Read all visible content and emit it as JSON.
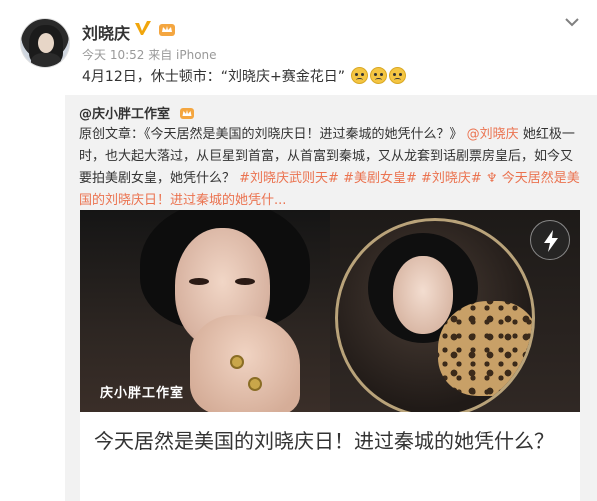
{
  "post": {
    "author_name": "刘晓庆",
    "meta": "今天 10:52 来自 iPhone",
    "text": "4月12日，休士顿市：“刘晓庆+赛金花日”"
  },
  "repost": {
    "author": "@庆小胖工作室",
    "body_prefix": "原创文章：《今天居然是美国的刘晓庆日！进过秦城的她凭什么？》",
    "mention": "@刘晓庆",
    "body_main": " 她红极一时，也大起大落过，从巨星到首富，从首富到秦城，又从龙套到话剧票房皇后，如今又要拍美剧女皇，她凭什么？",
    "tags": [
      "#刘晓庆武则天#",
      "#美剧女皇#",
      "#刘晓庆#"
    ],
    "link_text": "♆ 今天居然是美国的刘晓庆日！进过秦城的她凭什...",
    "media_watermark": "庆小胖工作室",
    "card_title": "今天居然是美国的刘晓庆日！进过秦城的她凭什么？"
  },
  "icons": {
    "avatar": "avatar",
    "vip": "verified-v-icon",
    "member": "member-crown-icon",
    "menu": "chevron-down-icon",
    "emoji": "emoji-face-icon",
    "lightning": "lightning-icon"
  },
  "colors": {
    "link": "#eb7350",
    "vip_gold": "#f1a60c",
    "repost_bg": "#f2f2f2"
  }
}
